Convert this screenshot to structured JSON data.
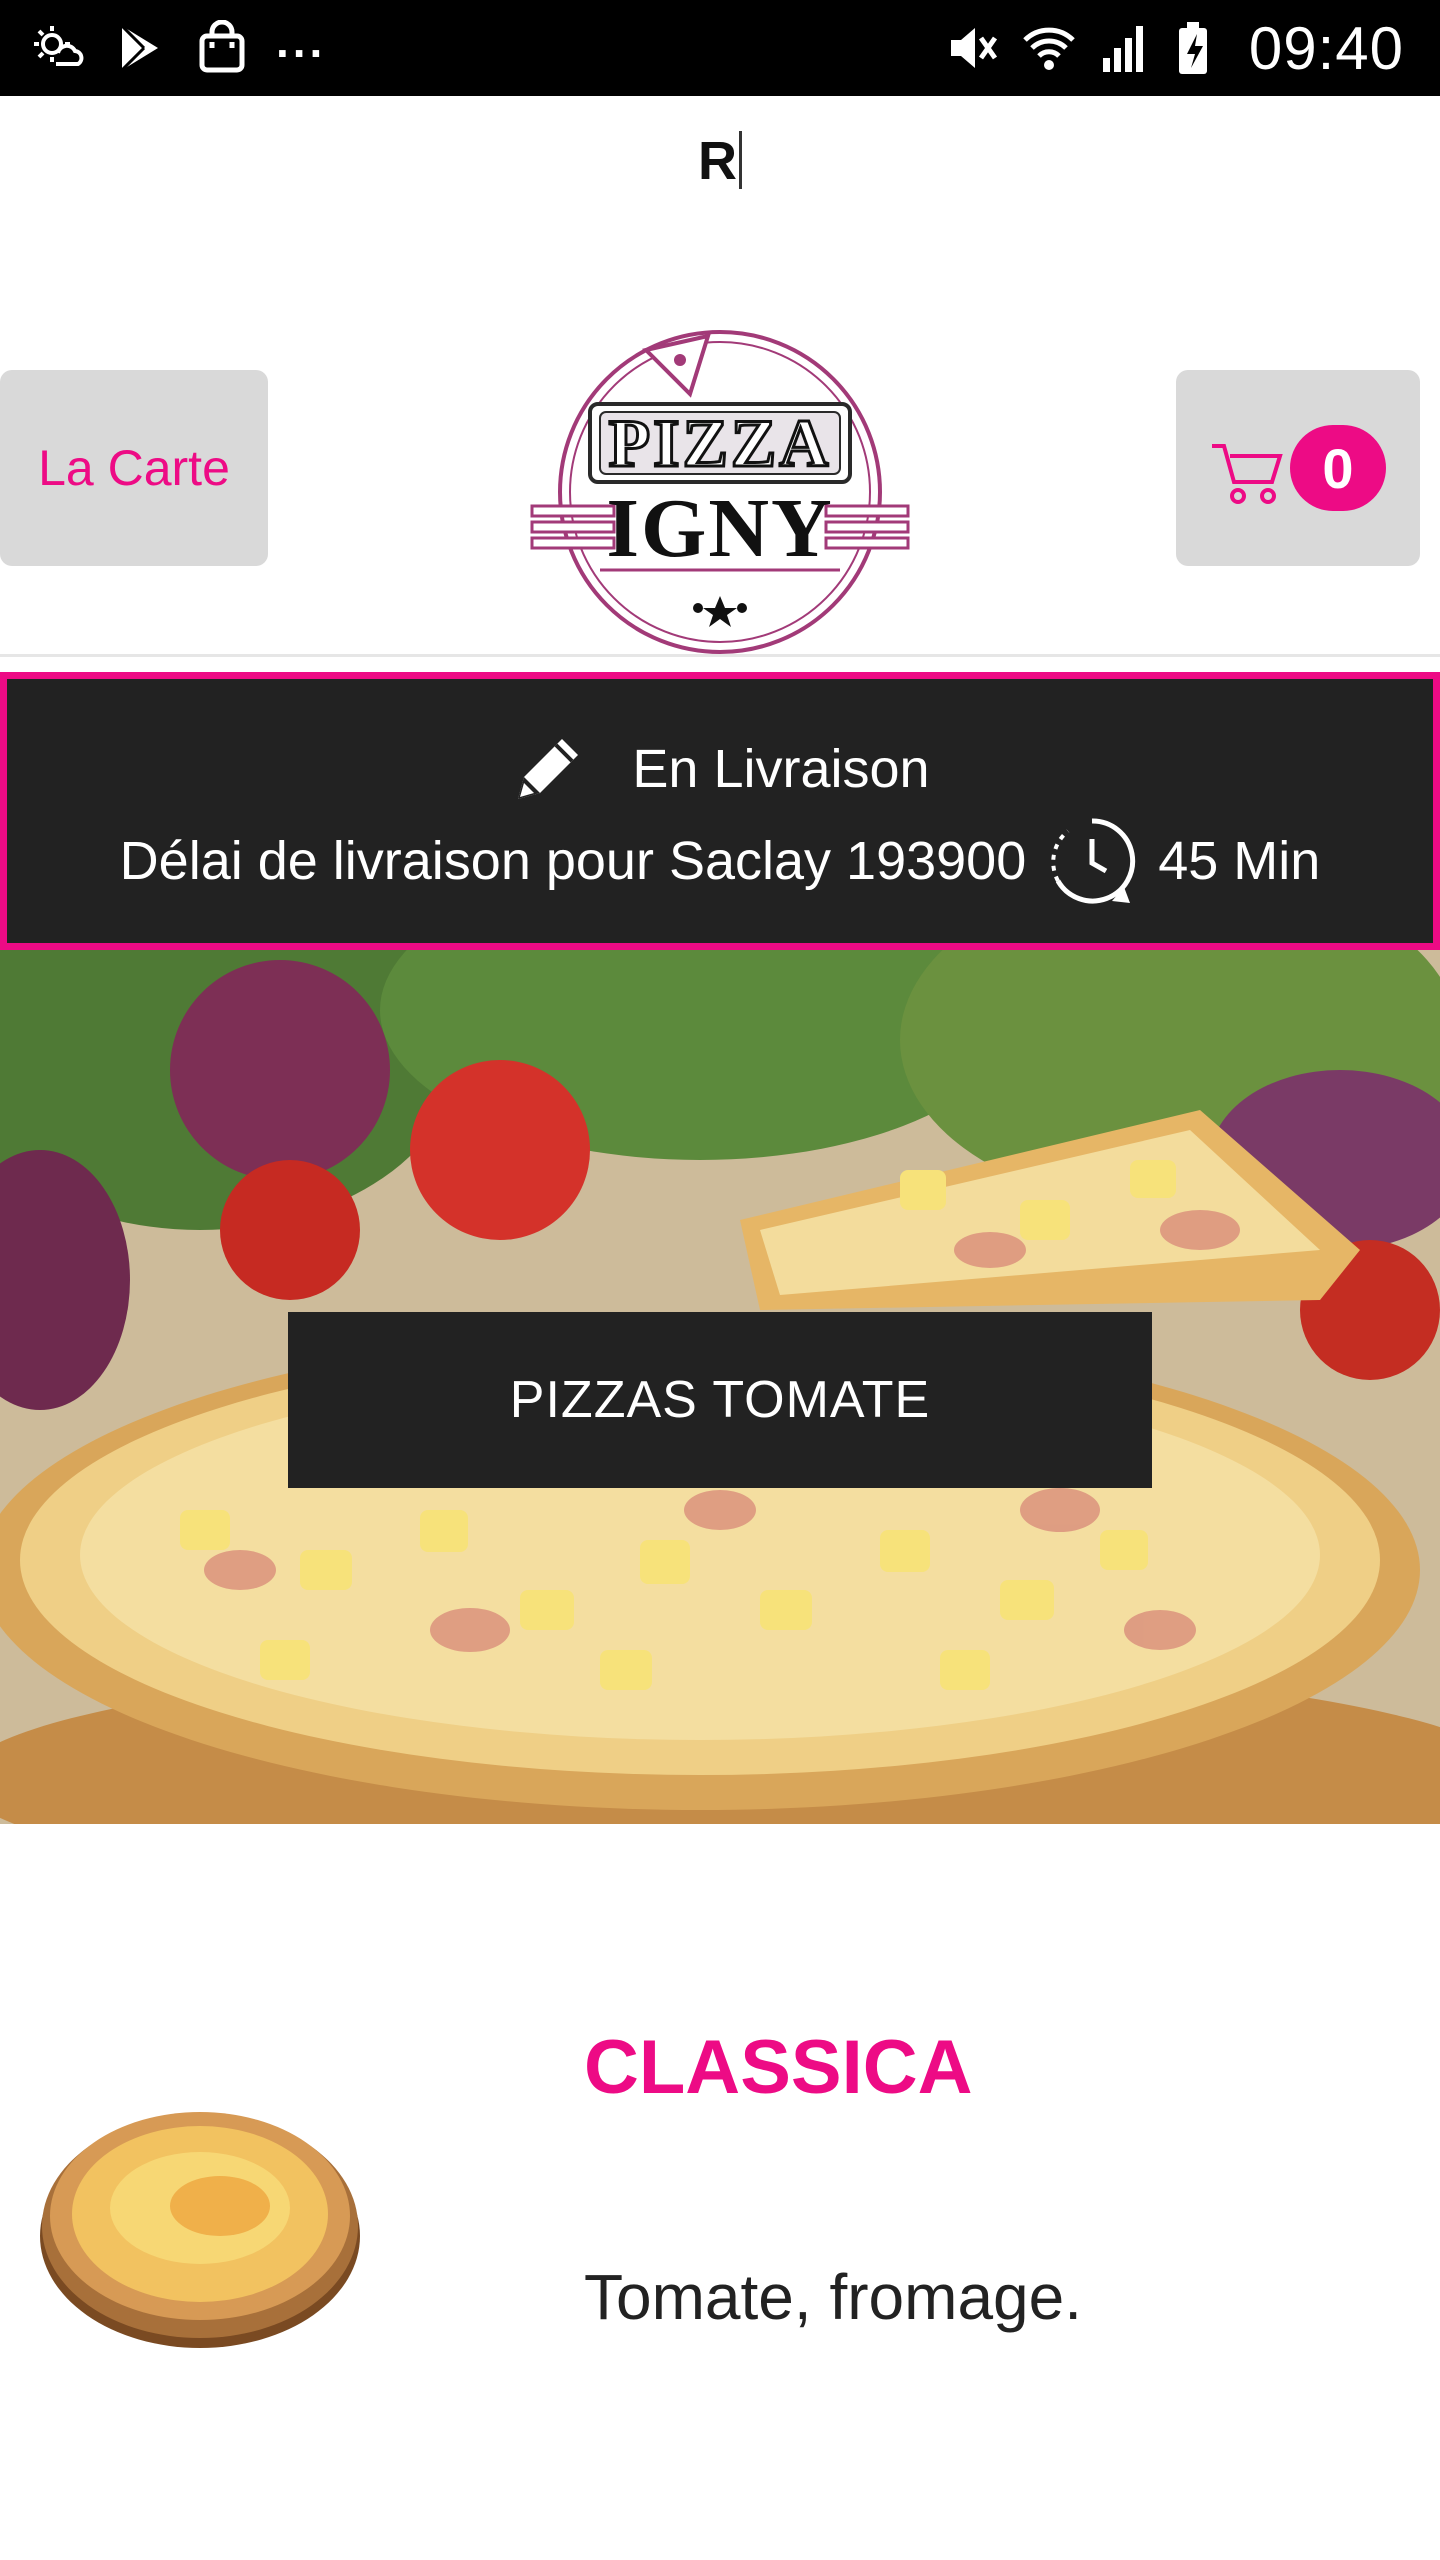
{
  "status_bar": {
    "time": "09:40",
    "dots": "...",
    "left_icons": [
      "weather-icon",
      "play-store-icon",
      "shopping-bag-icon"
    ],
    "right_icons": [
      "mute-icon",
      "wifi-icon",
      "signal-icon",
      "battery-icon"
    ]
  },
  "input": {
    "value": "R"
  },
  "header": {
    "carte_label": "La Carte",
    "cart_count": "0",
    "logo_top": "PIZZA",
    "logo_bottom": "IGNY"
  },
  "delivery": {
    "mode": "En Livraison",
    "delay_text": "Délai de livraison pour Saclay 193900",
    "delay_value": "45 Min"
  },
  "hero": {
    "category_label": "PIZZAS TOMATE"
  },
  "product": {
    "name": "CLASSICA",
    "description": "Tomate, fromage."
  },
  "colors": {
    "accent": "#ed0b85",
    "dark": "#222222",
    "button_bg": "#d9d9d9"
  }
}
